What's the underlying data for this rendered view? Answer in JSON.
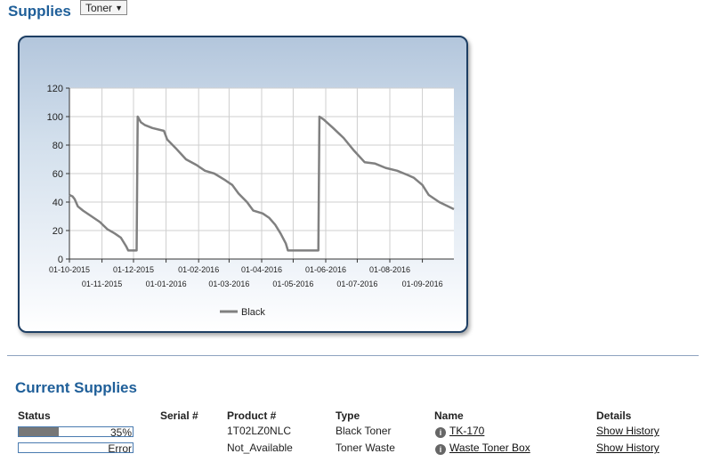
{
  "header": {
    "title": "Supplies",
    "select_value": "Toner"
  },
  "chart_data": {
    "type": "line",
    "ylim": [
      0,
      120
    ],
    "yticks": [
      0,
      20,
      40,
      60,
      80,
      100,
      120
    ],
    "xlim": [
      "2015-10-01",
      "2016-10-01"
    ],
    "xticks": [
      "2015-10-01",
      "2015-11-01",
      "2015-12-01",
      "2016-01-01",
      "2016-02-01",
      "2016-03-01",
      "2016-04-01",
      "2016-05-01",
      "2016-06-01",
      "2016-07-01",
      "2016-08-01",
      "2016-09-01"
    ],
    "xtick_labels": [
      "01-10-2015",
      "01-11-2015",
      "01-12-2015",
      "01-01-2016",
      "01-02-2016",
      "01-03-2016",
      "01-04-2016",
      "01-05-2016",
      "01-06-2016",
      "01-07-2016",
      "01-08-2016",
      "01-09-2016"
    ],
    "grid": true,
    "legend": "bottom",
    "series": [
      {
        "name": "Black",
        "color": "#808080",
        "points": [
          [
            "2015-10-01",
            45
          ],
          [
            "2015-10-04",
            44
          ],
          [
            "2015-10-06",
            42
          ],
          [
            "2015-10-09",
            37
          ],
          [
            "2015-10-14",
            34
          ],
          [
            "2015-10-22",
            30
          ],
          [
            "2015-10-30",
            26
          ],
          [
            "2015-11-06",
            21
          ],
          [
            "2015-11-13",
            18
          ],
          [
            "2015-11-19",
            15
          ],
          [
            "2015-11-24",
            9
          ],
          [
            "2015-11-26",
            6
          ],
          [
            "2015-12-04",
            6
          ],
          [
            "2015-12-05",
            100
          ],
          [
            "2015-12-08",
            96
          ],
          [
            "2015-12-12",
            94
          ],
          [
            "2015-12-19",
            92
          ],
          [
            "2015-12-30",
            90
          ],
          [
            "2016-01-02",
            84
          ],
          [
            "2016-01-10",
            78
          ],
          [
            "2016-01-20",
            70
          ],
          [
            "2016-01-30",
            66
          ],
          [
            "2016-02-07",
            62
          ],
          [
            "2016-02-16",
            60
          ],
          [
            "2016-02-25",
            56
          ],
          [
            "2016-03-04",
            52
          ],
          [
            "2016-03-10",
            46
          ],
          [
            "2016-03-18",
            40
          ],
          [
            "2016-03-24",
            34
          ],
          [
            "2016-04-02",
            32
          ],
          [
            "2016-04-08",
            29
          ],
          [
            "2016-04-14",
            24
          ],
          [
            "2016-04-19",
            18
          ],
          [
            "2016-04-24",
            11
          ],
          [
            "2016-04-26",
            6
          ],
          [
            "2016-05-10",
            6
          ],
          [
            "2016-05-25",
            6
          ],
          [
            "2016-05-26",
            100
          ],
          [
            "2016-05-30",
            98
          ],
          [
            "2016-06-08",
            92
          ],
          [
            "2016-06-18",
            85
          ],
          [
            "2016-06-28",
            76
          ],
          [
            "2016-07-08",
            68
          ],
          [
            "2016-07-18",
            67
          ],
          [
            "2016-07-28",
            64
          ],
          [
            "2016-08-08",
            62
          ],
          [
            "2016-08-18",
            59
          ],
          [
            "2016-08-24",
            57
          ],
          [
            "2016-09-01",
            52
          ],
          [
            "2016-09-07",
            45
          ],
          [
            "2016-09-17",
            40
          ],
          [
            "2016-10-01",
            35
          ]
        ]
      }
    ]
  },
  "current_supplies": {
    "title": "Current Supplies",
    "headers": {
      "status": "Status",
      "serial": "Serial #",
      "product": "Product #",
      "type": "Type",
      "name": "Name",
      "details": "Details"
    },
    "rows": [
      {
        "status_text": "35%",
        "level": 0.35,
        "product": "1T02LZ0NLC",
        "type": "Black Toner",
        "name": "TK-170",
        "details": "Show History"
      },
      {
        "status_text": "Error",
        "level": 0,
        "product": "Not_Available",
        "type": "Toner Waste",
        "name": "Waste Toner Box",
        "details": "Show History"
      }
    ]
  }
}
